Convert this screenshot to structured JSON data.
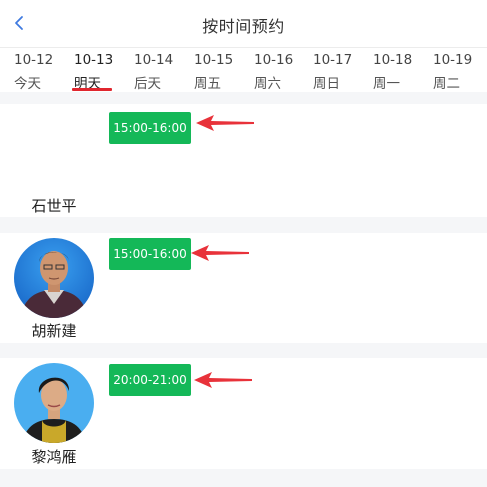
{
  "header": {
    "title": "按时间预约",
    "back_icon": "chevron-left-icon"
  },
  "dates": [
    {
      "date": "10-12",
      "label": "今天",
      "active": false
    },
    {
      "date": "10-13",
      "label": "明天",
      "active": true
    },
    {
      "date": "10-14",
      "label": "后天",
      "active": false
    },
    {
      "date": "10-15",
      "label": "周五",
      "active": false
    },
    {
      "date": "10-16",
      "label": "周六",
      "active": false
    },
    {
      "date": "10-17",
      "label": "周日",
      "active": false
    },
    {
      "date": "10-18",
      "label": "周一",
      "active": false
    },
    {
      "date": "10-19",
      "label": "周二",
      "active": false
    }
  ],
  "doctors": [
    {
      "name": "石世平",
      "slot": "15:00-16:00",
      "has_photo": false
    },
    {
      "name": "胡新建",
      "slot": "15:00-16:00",
      "has_photo": true
    },
    {
      "name": "黎鸿雁",
      "slot": "20:00-21:00",
      "has_photo": true
    }
  ],
  "colors": {
    "slot_bg": "#14b858",
    "arrow": "#e8323a",
    "tab_underline": "#e0262e",
    "separator": "#f5f6f8",
    "back_icon": "#3f7ae0"
  }
}
